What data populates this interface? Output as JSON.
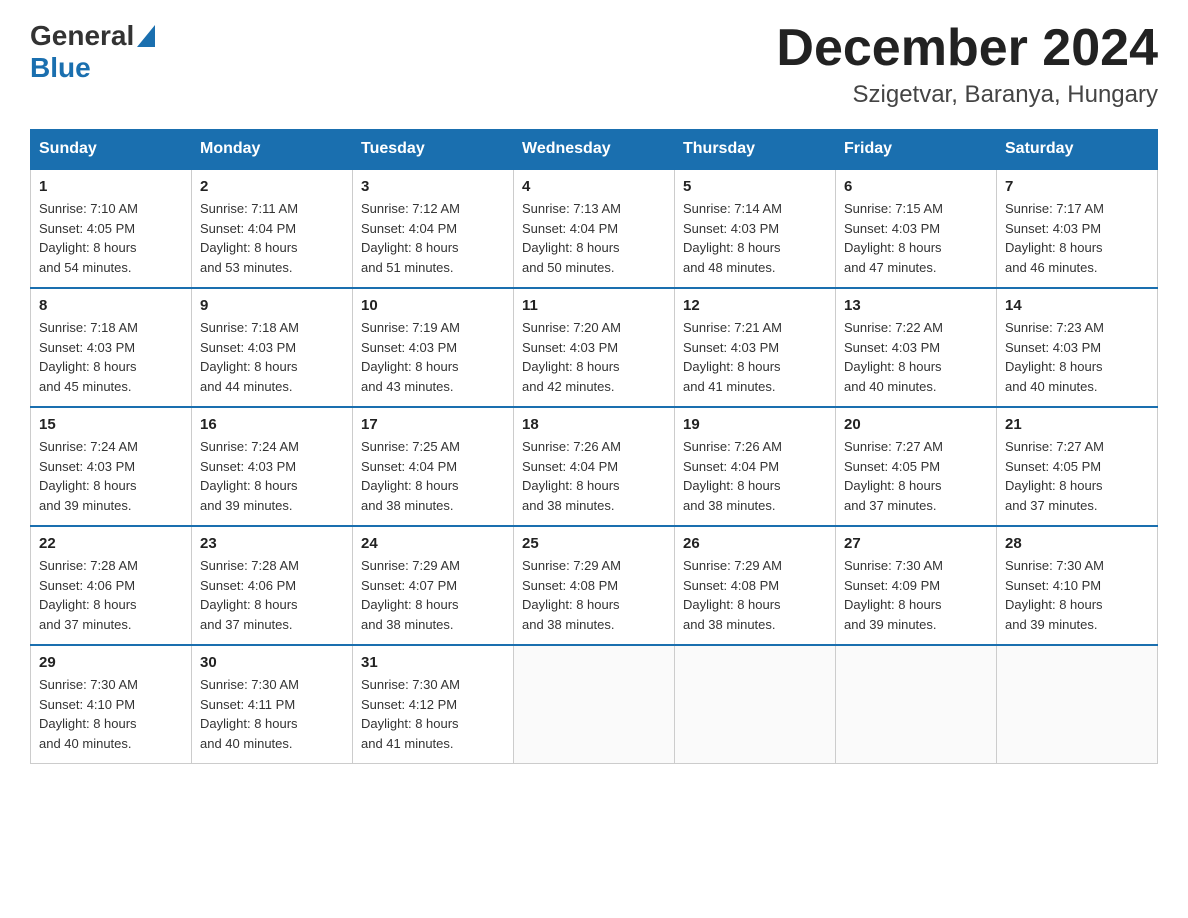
{
  "logo": {
    "general": "General",
    "blue": "Blue"
  },
  "title": "December 2024",
  "location": "Szigetvar, Baranya, Hungary",
  "days_of_week": [
    "Sunday",
    "Monday",
    "Tuesday",
    "Wednesday",
    "Thursday",
    "Friday",
    "Saturday"
  ],
  "weeks": [
    [
      {
        "day": "1",
        "sunrise": "7:10 AM",
        "sunset": "4:05 PM",
        "daylight": "8 hours and 54 minutes."
      },
      {
        "day": "2",
        "sunrise": "7:11 AM",
        "sunset": "4:04 PM",
        "daylight": "8 hours and 53 minutes."
      },
      {
        "day": "3",
        "sunrise": "7:12 AM",
        "sunset": "4:04 PM",
        "daylight": "8 hours and 51 minutes."
      },
      {
        "day": "4",
        "sunrise": "7:13 AM",
        "sunset": "4:04 PM",
        "daylight": "8 hours and 50 minutes."
      },
      {
        "day": "5",
        "sunrise": "7:14 AM",
        "sunset": "4:03 PM",
        "daylight": "8 hours and 48 minutes."
      },
      {
        "day": "6",
        "sunrise": "7:15 AM",
        "sunset": "4:03 PM",
        "daylight": "8 hours and 47 minutes."
      },
      {
        "day": "7",
        "sunrise": "7:17 AM",
        "sunset": "4:03 PM",
        "daylight": "8 hours and 46 minutes."
      }
    ],
    [
      {
        "day": "8",
        "sunrise": "7:18 AM",
        "sunset": "4:03 PM",
        "daylight": "8 hours and 45 minutes."
      },
      {
        "day": "9",
        "sunrise": "7:18 AM",
        "sunset": "4:03 PM",
        "daylight": "8 hours and 44 minutes."
      },
      {
        "day": "10",
        "sunrise": "7:19 AM",
        "sunset": "4:03 PM",
        "daylight": "8 hours and 43 minutes."
      },
      {
        "day": "11",
        "sunrise": "7:20 AM",
        "sunset": "4:03 PM",
        "daylight": "8 hours and 42 minutes."
      },
      {
        "day": "12",
        "sunrise": "7:21 AM",
        "sunset": "4:03 PM",
        "daylight": "8 hours and 41 minutes."
      },
      {
        "day": "13",
        "sunrise": "7:22 AM",
        "sunset": "4:03 PM",
        "daylight": "8 hours and 40 minutes."
      },
      {
        "day": "14",
        "sunrise": "7:23 AM",
        "sunset": "4:03 PM",
        "daylight": "8 hours and 40 minutes."
      }
    ],
    [
      {
        "day": "15",
        "sunrise": "7:24 AM",
        "sunset": "4:03 PM",
        "daylight": "8 hours and 39 minutes."
      },
      {
        "day": "16",
        "sunrise": "7:24 AM",
        "sunset": "4:03 PM",
        "daylight": "8 hours and 39 minutes."
      },
      {
        "day": "17",
        "sunrise": "7:25 AM",
        "sunset": "4:04 PM",
        "daylight": "8 hours and 38 minutes."
      },
      {
        "day": "18",
        "sunrise": "7:26 AM",
        "sunset": "4:04 PM",
        "daylight": "8 hours and 38 minutes."
      },
      {
        "day": "19",
        "sunrise": "7:26 AM",
        "sunset": "4:04 PM",
        "daylight": "8 hours and 38 minutes."
      },
      {
        "day": "20",
        "sunrise": "7:27 AM",
        "sunset": "4:05 PM",
        "daylight": "8 hours and 37 minutes."
      },
      {
        "day": "21",
        "sunrise": "7:27 AM",
        "sunset": "4:05 PM",
        "daylight": "8 hours and 37 minutes."
      }
    ],
    [
      {
        "day": "22",
        "sunrise": "7:28 AM",
        "sunset": "4:06 PM",
        "daylight": "8 hours and 37 minutes."
      },
      {
        "day": "23",
        "sunrise": "7:28 AM",
        "sunset": "4:06 PM",
        "daylight": "8 hours and 37 minutes."
      },
      {
        "day": "24",
        "sunrise": "7:29 AM",
        "sunset": "4:07 PM",
        "daylight": "8 hours and 38 minutes."
      },
      {
        "day": "25",
        "sunrise": "7:29 AM",
        "sunset": "4:08 PM",
        "daylight": "8 hours and 38 minutes."
      },
      {
        "day": "26",
        "sunrise": "7:29 AM",
        "sunset": "4:08 PM",
        "daylight": "8 hours and 38 minutes."
      },
      {
        "day": "27",
        "sunrise": "7:30 AM",
        "sunset": "4:09 PM",
        "daylight": "8 hours and 39 minutes."
      },
      {
        "day": "28",
        "sunrise": "7:30 AM",
        "sunset": "4:10 PM",
        "daylight": "8 hours and 39 minutes."
      }
    ],
    [
      {
        "day": "29",
        "sunrise": "7:30 AM",
        "sunset": "4:10 PM",
        "daylight": "8 hours and 40 minutes."
      },
      {
        "day": "30",
        "sunrise": "7:30 AM",
        "sunset": "4:11 PM",
        "daylight": "8 hours and 40 minutes."
      },
      {
        "day": "31",
        "sunrise": "7:30 AM",
        "sunset": "4:12 PM",
        "daylight": "8 hours and 41 minutes."
      },
      null,
      null,
      null,
      null
    ]
  ],
  "labels": {
    "sunrise": "Sunrise:",
    "sunset": "Sunset:",
    "daylight": "Daylight:"
  }
}
